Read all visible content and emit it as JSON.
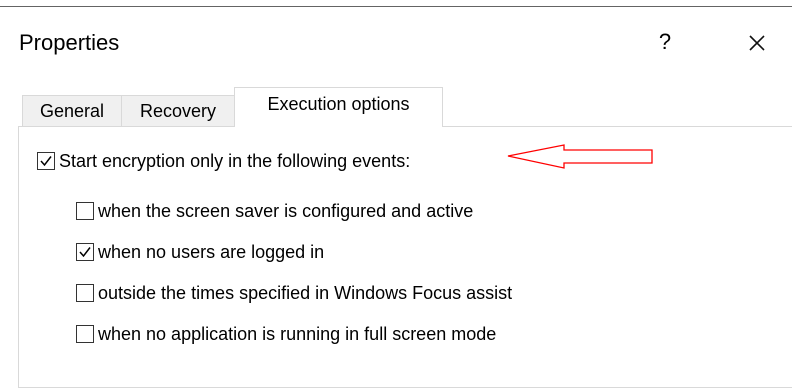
{
  "window": {
    "title": "Properties",
    "help_label": "?",
    "icons": {
      "close": "close-icon"
    }
  },
  "tabs": [
    {
      "label": "General"
    },
    {
      "label": "Recovery"
    },
    {
      "label": "Execution options"
    }
  ],
  "main": {
    "master_checkbox": {
      "label": "Start encryption only in the following events:",
      "checked": true
    },
    "options": [
      {
        "label": "when the screen saver is configured and active",
        "checked": false
      },
      {
        "label": "when no users are logged in",
        "checked": true
      },
      {
        "label": "outside the times specified in Windows Focus assist",
        "checked": false
      },
      {
        "label": "when no application is running in full screen mode",
        "checked": false
      }
    ]
  },
  "annotation": {
    "arrow_color": "#ff0000"
  }
}
